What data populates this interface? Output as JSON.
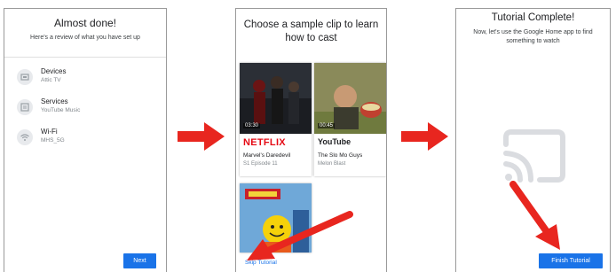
{
  "screen1": {
    "title": "Almost done!",
    "subtitle": "Here's a review of what you have set up",
    "items": [
      {
        "label": "Devices",
        "value": "Attic TV",
        "icon": "tv-icon"
      },
      {
        "label": "Services",
        "value": "YouTube Music",
        "icon": "services-icon"
      },
      {
        "label": "Wi-Fi",
        "value": "MHS_5G",
        "icon": "wifi-icon"
      }
    ],
    "next_label": "Next"
  },
  "screen2": {
    "title": "Choose a sample clip to learn how to cast",
    "clips": [
      {
        "brand": "NETFLIX",
        "duration": "03:30",
        "title": "Marvel's Daredevil",
        "subtitle": "S1 Episode 11"
      },
      {
        "brand": "YouTube",
        "duration": "00:45",
        "title": "The Slo Mo Guys",
        "subtitle": "Melon Blast"
      },
      {
        "brand": "",
        "duration": "",
        "title": "",
        "subtitle": ""
      }
    ],
    "skip_label": "Skip Tutorial"
  },
  "screen3": {
    "title": "Tutorial Complete!",
    "subtitle": "Now, let's use the Google Home app to find something to watch",
    "finish_label": "Finish Tutorial",
    "icon": "cast-icon"
  },
  "colors": {
    "accent": "#1a73e8",
    "arrow": "#e8261f",
    "netflix": "#e50914",
    "youtube": "#ff0000"
  }
}
